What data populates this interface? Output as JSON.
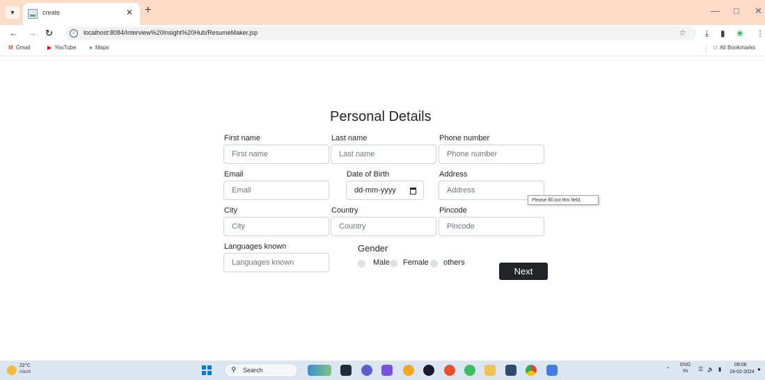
{
  "browser": {
    "tab_title": "create",
    "url": "localhost:8084/Interview%20Insight%20Hub/ResumeMaker.jsp",
    "bookmarks": [
      "Gmail",
      "YouTube",
      "Maps"
    ],
    "all_bookmarks": "All Bookmarks"
  },
  "form": {
    "title": "Personal Details",
    "first_name": {
      "label": "First name",
      "placeholder": "First name"
    },
    "last_name": {
      "label": "Last name",
      "placeholder": "Last name"
    },
    "phone": {
      "label": "Phone number",
      "placeholder": "Phone number"
    },
    "email": {
      "label": "Email",
      "placeholder": "Email"
    },
    "dob": {
      "label": "Date of Birth",
      "value": "dd-mm-yyyy"
    },
    "address": {
      "label": "Address",
      "placeholder": "Address"
    },
    "city": {
      "label": "City",
      "placeholder": "City"
    },
    "country": {
      "label": "Country",
      "placeholder": "Country"
    },
    "pincode": {
      "label": "Pincode",
      "placeholder": "Pincode"
    },
    "languages": {
      "label": "Languages known",
      "placeholder": "Languages known"
    },
    "gender": {
      "label": "Gender",
      "options": [
        "Male",
        "Female",
        "others"
      ]
    },
    "next_label": "Next",
    "validation_tooltip": "Please fill out this field."
  },
  "taskbar": {
    "weather_temp": "22°C",
    "weather_desc": "Haze",
    "search_label": "Search",
    "lang_top": "ENG",
    "lang_bottom": "IN",
    "time": "09:08",
    "date": "19-02-2024"
  }
}
